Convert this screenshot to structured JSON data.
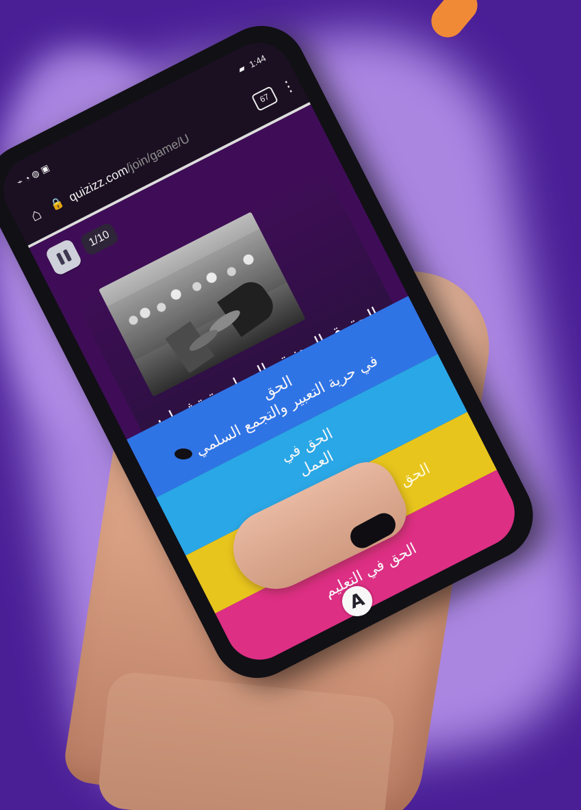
{
  "status": {
    "time": "1:44"
  },
  "browser": {
    "url_domain": "quizizz.com",
    "url_path": "/join/game/U",
    "tabs_count": "67"
  },
  "quiz": {
    "counter": "1/10",
    "question": "الحقوق المدنية والسياسية تشمل:",
    "answers": [
      "الحق\nفي حرية التعبير والتجمع السلمي",
      "الحق في\nالعمل",
      "الحق الضمان الصحي الاجتماعي",
      "الحق في التعليم"
    ],
    "colors": {
      "answer_1": "#2f74e5",
      "answer_2": "#2aa7e6",
      "answer_3": "#e7c51d",
      "answer_4": "#dd2f84",
      "background": "#4a1f96",
      "glow": "#b08ce6"
    }
  },
  "icons": {
    "home": "home-icon",
    "lock": "lock-icon",
    "menu": "kebab-menu-icon",
    "pause": "pause-icon",
    "floating": "text-icon"
  }
}
